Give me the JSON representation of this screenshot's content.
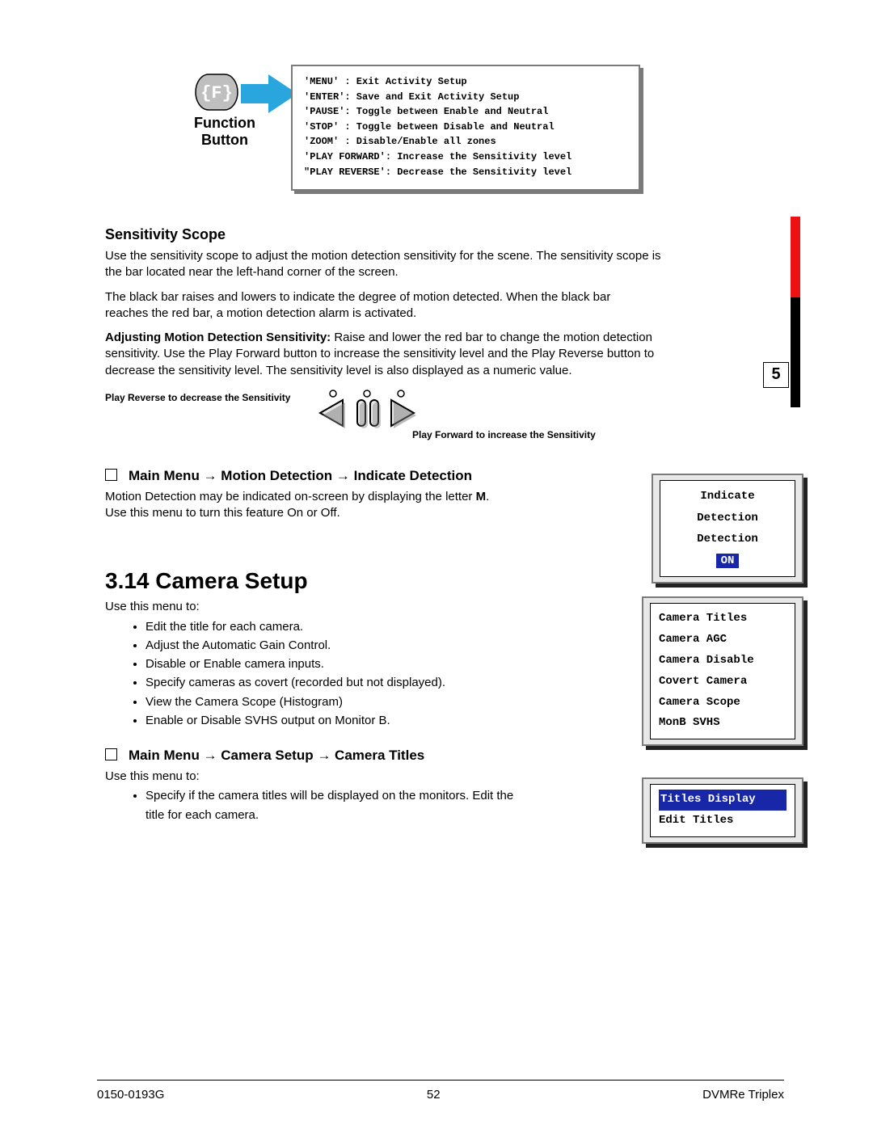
{
  "function_button": {
    "label_line1": "Function",
    "label_line2": "Button",
    "key_glyph": "{F}"
  },
  "commands": [
    "'MENU' : Exit Activity Setup",
    "'ENTER': Save and Exit Activity Setup",
    "'PAUSE': Toggle between Enable and Neutral",
    "'STOP' : Toggle between Disable and Neutral",
    "'ZOOM' : Disable/Enable all zones",
    "'PLAY FORWARD': Increase the Sensitivity level",
    "\"PLAY REVERSE': Decrease the Sensitivity level"
  ],
  "sensitivity_scope": {
    "heading": "Sensitivity Scope",
    "p1": "Use the sensitivity scope to adjust the motion detection sensitivity for the scene.  The sensitivity scope is the bar located near the left-hand corner of the screen.",
    "p2": "The black bar raises and lowers to indicate the degree of motion detected.  When the black bar reaches the red bar, a motion detection alarm is activated.",
    "p3_bold": "Adjusting Motion Detection Sensitivity:",
    "p3_rest": "  Raise and lower the red bar to change the motion detection sensitivity. Use the Play Forward button to increase the sensitivity level and the Play Reverse button to decrease the sensitivity level. The sensitivity level is also displayed as a numeric value.",
    "number_value": "5",
    "label_reverse": "Play Reverse to decrease the Sensitivity",
    "label_forward": "Play Forward to increase the Sensitivity"
  },
  "indicate_detection": {
    "breadcrumb": "Main Menu → Motion Detection → Indicate Detection",
    "body1": "Motion Detection may be indicated on-screen by displaying the letter ",
    "body1_bold": "M",
    "body1_end": ".",
    "body2": "Use this menu to turn this feature On or Off.",
    "menu": {
      "title": "Indicate Detection",
      "field": "Detection",
      "value": "ON"
    }
  },
  "camera_setup": {
    "heading": "3.14 Camera Setup",
    "intro": "Use this menu to:",
    "bullets": [
      "Edit the title for each camera.",
      "Adjust the Automatic Gain Control.",
      "Disable or Enable camera inputs.",
      "Specify cameras as covert (recorded but not displayed).",
      "View the Camera Scope (Histogram)",
      "Enable or Disable SVHS output on Monitor B."
    ],
    "menu_items": [
      "Camera Titles",
      "Camera AGC",
      "Camera Disable",
      "Covert Camera",
      "Camera Scope",
      "MonB SVHS"
    ]
  },
  "camera_titles": {
    "breadcrumb": "Main Menu → Camera Setup → Camera Titles",
    "intro": "Use this menu to:",
    "bullets": [
      "Specify if the camera titles will be displayed on the monitors. Edit the title for each camera."
    ],
    "menu_items": [
      "Titles Display",
      "Edit Titles"
    ],
    "selected_index": 0
  },
  "footer": {
    "left": "0150-0193G",
    "center": "52",
    "right": "DVMRe Triplex"
  }
}
